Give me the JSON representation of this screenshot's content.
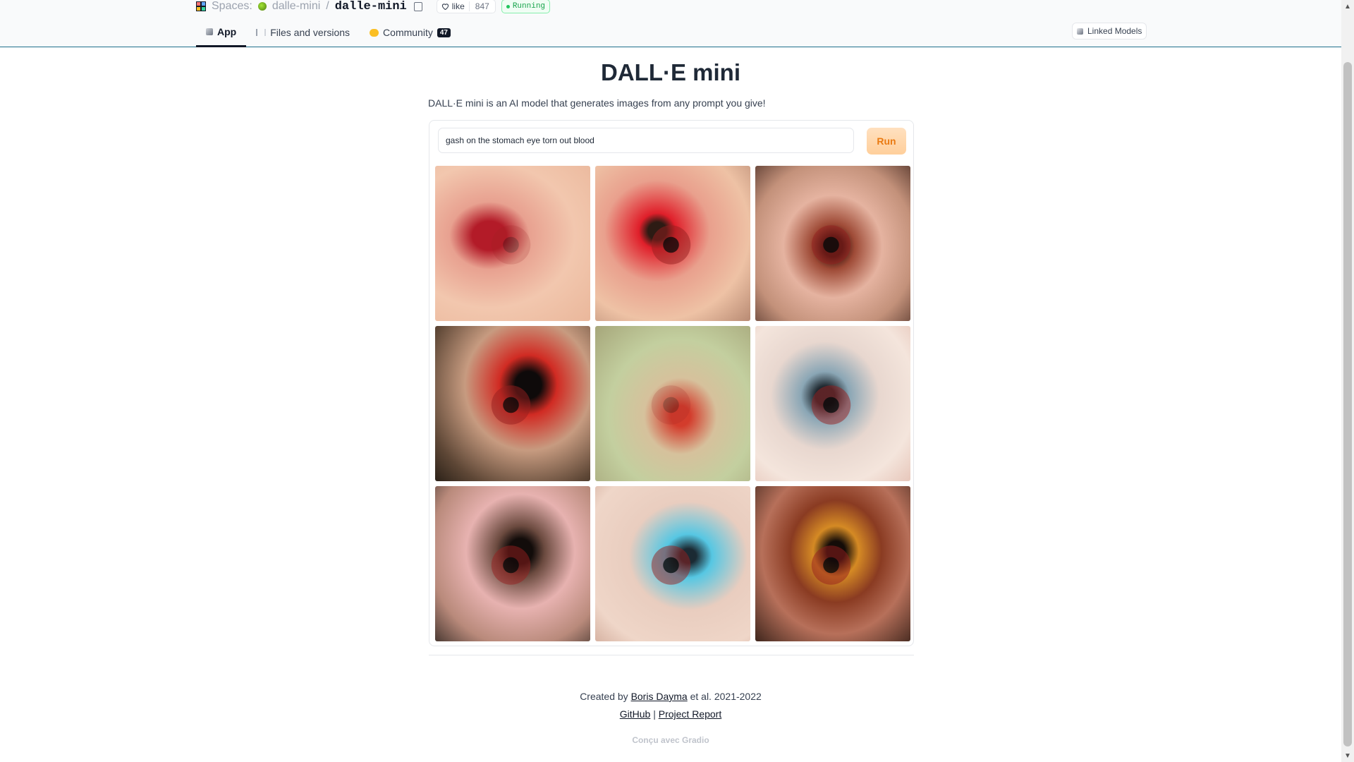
{
  "header": {
    "spaces_label": "Spaces:",
    "owner": "dalle-mini",
    "separator": "/",
    "repo": "dalle-mini",
    "like_label": "like",
    "like_count": "847",
    "status": "Running",
    "status_color": "#16a34a"
  },
  "tabs": [
    {
      "label": "App",
      "icon": "cube-icon",
      "active": true
    },
    {
      "label": "Files and versions",
      "icon": "files-icon",
      "active": false
    },
    {
      "label": "Community",
      "icon": "community-icon",
      "active": false,
      "badge": "47"
    }
  ],
  "linked_models_label": "Linked Models",
  "app": {
    "title": "DALL·E mini",
    "description": "DALL·E mini is an AI model that generates images from any prompt you give!",
    "prompt_value": "gash on the stomach eye torn out blood",
    "run_label": "Run",
    "accent": "#ea7a12"
  },
  "footer": {
    "created_prefix": "Created by",
    "author": "Boris Dayma",
    "created_suffix": "et al. 2021-2022",
    "github": "GitHub",
    "pipe": "|",
    "report": "Project Report",
    "built_with": "Conçu avec Gradio"
  }
}
